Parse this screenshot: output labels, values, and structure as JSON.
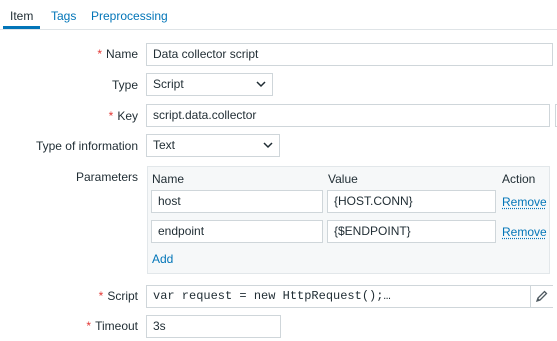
{
  "tabs": [
    {
      "label": "Item",
      "active": true
    },
    {
      "label": "Tags",
      "active": false
    },
    {
      "label": "Preprocessing",
      "active": false
    }
  ],
  "form": {
    "name": {
      "label": "Name",
      "required": true,
      "value": "Data collector script"
    },
    "type": {
      "label": "Type",
      "value": "Script"
    },
    "key": {
      "label": "Key",
      "required": true,
      "value": "script.data.collector"
    },
    "type_of_information": {
      "label": "Type of information",
      "value": "Text"
    },
    "parameters": {
      "label": "Parameters",
      "columns": {
        "name": "Name",
        "value": "Value",
        "action": "Action"
      },
      "rows": [
        {
          "name": "host",
          "value": "{HOST.CONN}",
          "action": "Remove"
        },
        {
          "name": "endpoint",
          "value": "{$ENDPOINT}",
          "action": "Remove"
        }
      ],
      "add_label": "Add"
    },
    "script": {
      "label": "Script",
      "required": true,
      "value": "var request = new HttpRequest();…",
      "edit_icon": "pencil-icon"
    },
    "timeout": {
      "label": "Timeout",
      "required": true,
      "value": "3s"
    }
  },
  "colors": {
    "accent": "#0275b8",
    "required": "#e33734",
    "border": "#cfd6da"
  }
}
